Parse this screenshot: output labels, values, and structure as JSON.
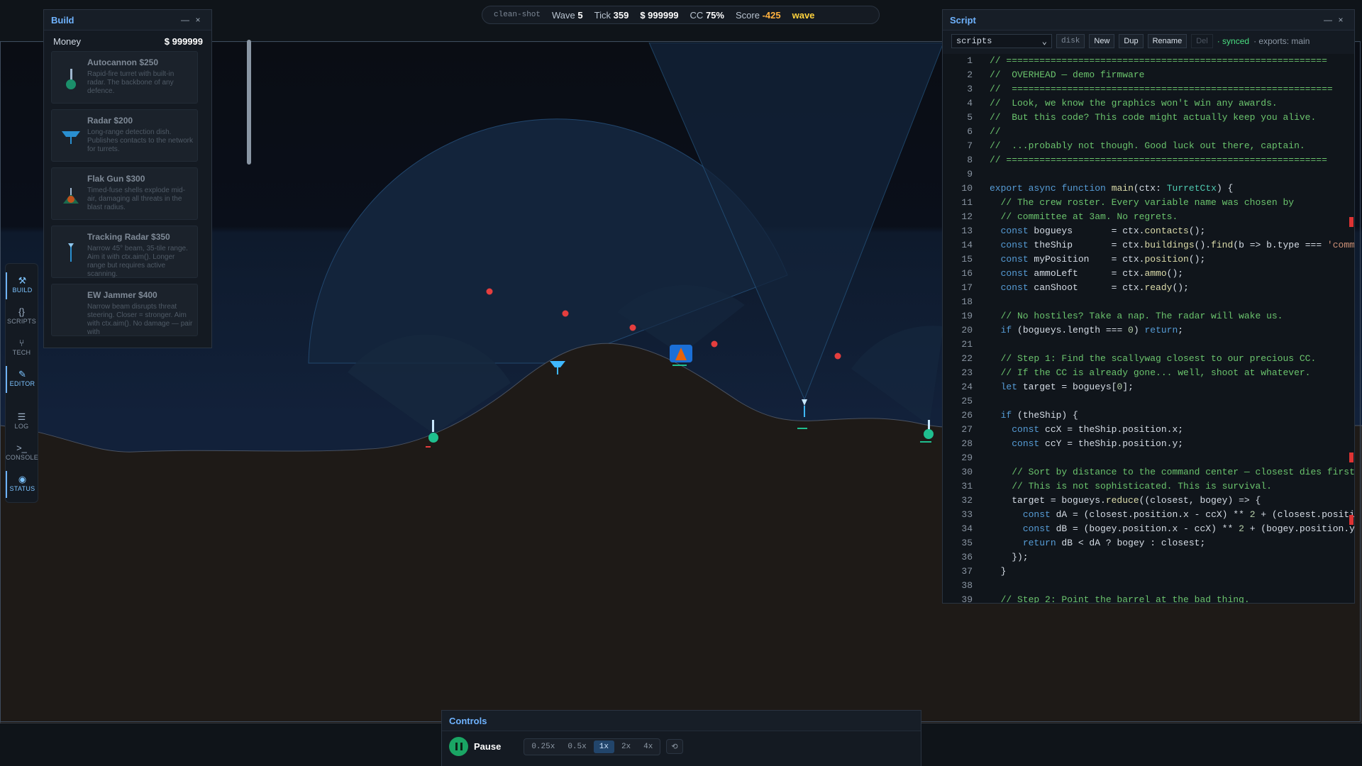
{
  "hud": {
    "tag": "clean-shot",
    "wave_label": "Wave",
    "wave_value": "5",
    "tick_label": "Tick",
    "tick_value": "359",
    "money_value": "$ 999999",
    "cc_label": "CC",
    "cc_value": "75%",
    "score_label": "Score",
    "score_value": "-425",
    "phase": "wave"
  },
  "build": {
    "title": "Build",
    "minimize": "—",
    "close": "×",
    "money_label": "Money",
    "money_value": "$ 999999",
    "items": [
      {
        "name": "Autocannon $250",
        "desc": "Rapid-fire turret with built-in radar. The backbone of any defence.",
        "icon": "autocannon-icon"
      },
      {
        "name": "Radar $200",
        "desc": "Long-range detection dish. Publishes contacts to the network for turrets.",
        "icon": "radar-icon"
      },
      {
        "name": "Flak Gun $300",
        "desc": "Timed-fuse shells explode mid-air, damaging all threats in the blast radius.",
        "icon": "flak-gun-icon"
      },
      {
        "name": "Tracking Radar $350",
        "desc": "Narrow 45° beam, 35-tile range. Aim it with ctx.aim(). Longer range but requires active scanning.",
        "icon": "tracking-radar-icon"
      },
      {
        "name": "EW Jammer $400",
        "desc": "Narrow beam disrupts threat steering. Closer = stronger. Aim with ctx.aim(). No damage — pair with",
        "icon": "ew-jammer-icon"
      }
    ]
  },
  "rail": {
    "items": [
      {
        "label": "BUILD",
        "glyph": "⚒",
        "active": true
      },
      {
        "label": "SCRIPTS",
        "glyph": "{}",
        "active": false
      },
      {
        "label": "TECH",
        "glyph": "⑂",
        "active": false
      },
      {
        "label": "EDITOR",
        "glyph": "✎",
        "active": true
      },
      {
        "label": "LOG",
        "glyph": "☰",
        "active": false
      },
      {
        "label": "CONSOLE",
        "glyph": ">_",
        "active": false
      },
      {
        "label": "STATUS",
        "glyph": "◉",
        "active": true
      }
    ]
  },
  "script": {
    "title": "Script",
    "minimize": "—",
    "close": "×",
    "select_value": "scripts",
    "buttons": {
      "disk": "disk",
      "new": "New",
      "dup": "Dup",
      "rename": "Rename",
      "del": "Del"
    },
    "status": "· synced",
    "exports": "· exports: main",
    "lines": [
      "// ==========================================================",
      "//  OVERHEAD — demo firmware",
      "//  ==========================================================",
      "//  Look, we know the graphics won't win any awards.",
      "//  But this code? This code might actually keep you alive.",
      "//",
      "//  ...probably not though. Good luck out there, captain.",
      "// ==========================================================",
      "",
      "export async function main(ctx: TurretCtx) {",
      "  // The crew roster. Every variable name was chosen by",
      "  // committee at 3am. No regrets.",
      "  const bogueys       = ctx.contacts();",
      "  const theShip       = ctx.buildings().find(b => b.type === 'comm",
      "  const myPosition    = ctx.position();",
      "  const ammoLeft      = ctx.ammo();",
      "  const canShoot      = ctx.ready();",
      "",
      "  // No hostiles? Take a nap. The radar will wake us.",
      "  if (bogueys.length === 0) return;",
      "",
      "  // Step 1: Find the scallywag closest to our precious CC.",
      "  // If the CC is already gone... well, shoot at whatever.",
      "  let target = bogueys[0];",
      "",
      "  if (theShip) {",
      "    const ccX = theShip.position.x;",
      "    const ccY = theShip.position.y;",
      "",
      "    // Sort by distance to the command center — closest dies first",
      "    // This is not sophisticated. This is survival.",
      "    target = bogueys.reduce((closest, bogey) => {",
      "      const dA = (closest.position.x - ccX) ** 2 + (closest.positi",
      "      const dB = (bogey.position.x - ccX) ** 2 + (bogey.position.y",
      "      return dB < dA ? bogey : closest;",
      "    });",
      "  }",
      "",
      "  // Step 2: Point the barrel at the bad thing."
    ]
  },
  "controls": {
    "title": "Controls",
    "pause_label": "Pause",
    "speeds": [
      "0.25x",
      "0.5x",
      "1x",
      "2x",
      "4x"
    ],
    "active_speed": "1x",
    "step_glyph": "⟲"
  },
  "colors": {
    "accent": "#6fb3ff",
    "terrain": "#1e1a17",
    "sky": "#0a0f1a",
    "threat": "#e53e3e",
    "friendly": "#1fbf8f",
    "comment": "#6bc46d",
    "synced": "#4ade80",
    "score_negative": "#ffb23f",
    "wave": "#ffd33d"
  }
}
